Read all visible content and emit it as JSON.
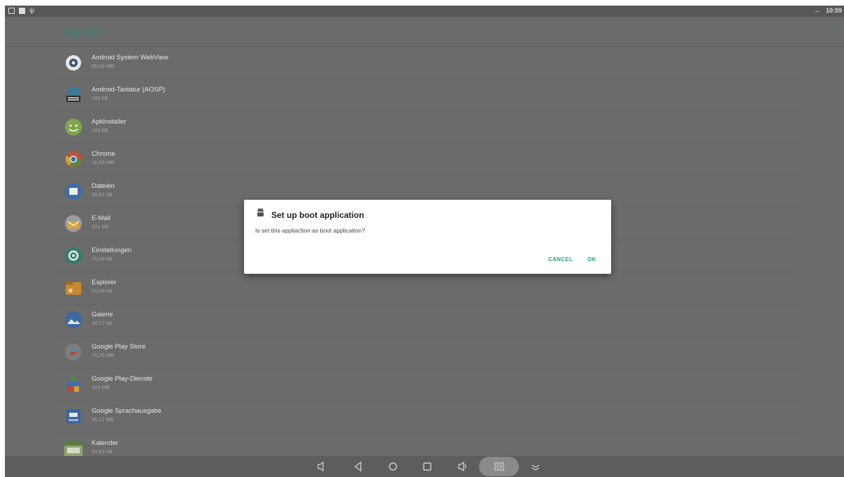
{
  "status_bar": {
    "time": "10:59",
    "right_glyph": "↔"
  },
  "toolbar": {
    "title": "App-Info"
  },
  "apps": [
    {
      "name": "Android System WebView",
      "size": "86,42 MB",
      "icon": "gear-icon"
    },
    {
      "name": "Android-Tastatur (AOSP)",
      "size": "100 kB",
      "icon": "keyboard-icon"
    },
    {
      "name": "ApkInstaller",
      "size": "102 kB",
      "icon": "android-icon"
    },
    {
      "name": "Chrome",
      "size": "16,05 MB",
      "icon": "chrome-icon"
    },
    {
      "name": "Dateien",
      "size": "28,67 kB",
      "icon": "folder-icon"
    },
    {
      "name": "E-Mail",
      "size": "201 kB",
      "icon": "email-icon"
    },
    {
      "name": "Einstellungen",
      "size": "75,26 kB",
      "icon": "settings-icon"
    },
    {
      "name": "Explorer",
      "size": "25,09 kB",
      "icon": "explorer-icon"
    },
    {
      "name": "Galerie",
      "size": "32,77 kB",
      "icon": "gallery-icon"
    },
    {
      "name": "Google Play Store",
      "size": "76,26 MB",
      "icon": "play-store-icon"
    },
    {
      "name": "Google Play-Dienste",
      "size": "153 MB",
      "icon": "play-services-icon"
    },
    {
      "name": "Google Sprachausgabe",
      "size": "35,11 MB",
      "icon": "tts-icon"
    },
    {
      "name": "Kalender",
      "size": "34,82 kB",
      "icon": "calendar-icon"
    }
  ],
  "dialog": {
    "title": "Set up boot application",
    "message": "Is set this appliaction as boot application?",
    "cancel_label": "CANCEL",
    "ok_label": "OK"
  },
  "colors": {
    "accent": "#2c9c8c",
    "scrim": "#6b6b6b"
  }
}
